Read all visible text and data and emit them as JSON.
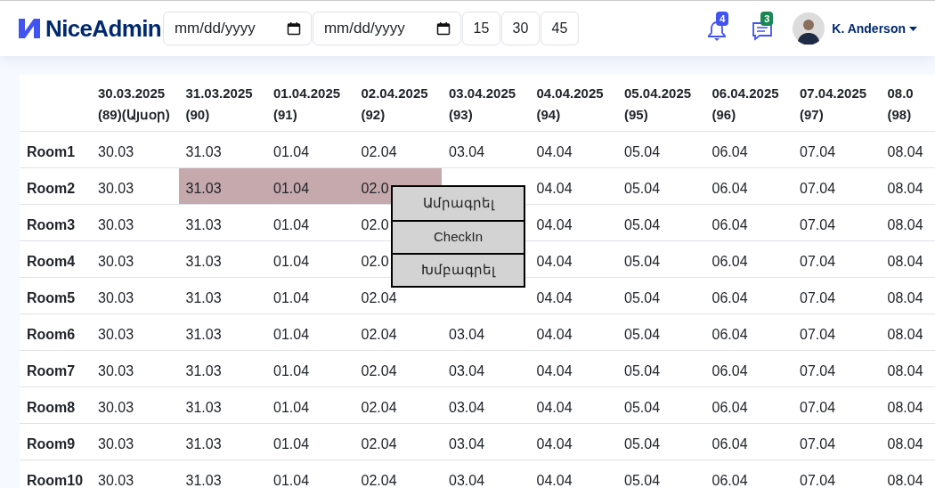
{
  "header": {
    "logo": "NiceAdmin",
    "date_fields": [
      {
        "placeholder": "mm/dd/yyyy"
      },
      {
        "placeholder": "mm/dd/yyyy"
      }
    ],
    "quick_buttons": [
      "15",
      "30",
      "45"
    ],
    "notifications": {
      "badge": "4"
    },
    "messages": {
      "badge": "3"
    },
    "user": {
      "name": "K. Anderson"
    }
  },
  "table": {
    "columns": [
      {
        "date": "30.03.2025",
        "sub": "(89)(Այսօր)"
      },
      {
        "date": "31.03.2025",
        "sub": "(90)"
      },
      {
        "date": "01.04.2025",
        "sub": "(91)"
      },
      {
        "date": "02.04.2025",
        "sub": "(92)"
      },
      {
        "date": "03.04.2025",
        "sub": "(93)"
      },
      {
        "date": "04.04.2025",
        "sub": "(94)"
      },
      {
        "date": "05.04.2025",
        "sub": "(95)"
      },
      {
        "date": "06.04.2025",
        "sub": "(96)"
      },
      {
        "date": "07.04.2025",
        "sub": "(97)"
      },
      {
        "date": "08.0",
        "sub": "(98)"
      }
    ],
    "rows": [
      {
        "room": "Room1",
        "cells": [
          {
            "text": "30.03",
            "booked": false
          },
          {
            "text": "31.03",
            "booked": false
          },
          {
            "text": "01.04",
            "booked": false
          },
          {
            "text": "02.04",
            "booked": false
          },
          {
            "text": "03.04",
            "booked": false
          },
          {
            "text": "04.04",
            "booked": false
          },
          {
            "text": "05.04",
            "booked": false
          },
          {
            "text": "06.04",
            "booked": false
          },
          {
            "text": "07.04",
            "booked": false
          },
          {
            "text": "08.04",
            "booked": false
          }
        ]
      },
      {
        "room": "Room2",
        "cells": [
          {
            "text": "30.03",
            "booked": false
          },
          {
            "text": "31.03",
            "booked": true
          },
          {
            "text": "01.04",
            "booked": true
          },
          {
            "text": "02.0",
            "booked": true
          },
          null,
          {
            "text": "04.04",
            "booked": false
          },
          {
            "text": "05.04",
            "booked": false
          },
          {
            "text": "06.04",
            "booked": false
          },
          {
            "text": "07.04",
            "booked": false
          },
          {
            "text": "08.04",
            "booked": false
          }
        ]
      },
      {
        "room": "Room3",
        "cells": [
          {
            "text": "30.03",
            "booked": false
          },
          {
            "text": "31.03",
            "booked": false
          },
          {
            "text": "01.04",
            "booked": false
          },
          {
            "text": "02.0",
            "booked": false
          },
          null,
          {
            "text": "04.04",
            "booked": false
          },
          {
            "text": "05.04",
            "booked": false
          },
          {
            "text": "06.04",
            "booked": false
          },
          {
            "text": "07.04",
            "booked": false
          },
          {
            "text": "08.04",
            "booked": false
          }
        ]
      },
      {
        "room": "Room4",
        "cells": [
          {
            "text": "30.03",
            "booked": false
          },
          {
            "text": "31.03",
            "booked": false
          },
          {
            "text": "01.04",
            "booked": false
          },
          {
            "text": "02.0",
            "booked": false
          },
          null,
          {
            "text": "04.04",
            "booked": false
          },
          {
            "text": "05.04",
            "booked": false
          },
          {
            "text": "06.04",
            "booked": false
          },
          {
            "text": "07.04",
            "booked": false
          },
          {
            "text": "08.04",
            "booked": false
          }
        ]
      },
      {
        "room": "Room5",
        "cells": [
          {
            "text": "30.03",
            "booked": false
          },
          {
            "text": "31.03",
            "booked": false
          },
          {
            "text": "01.04",
            "booked": false
          },
          {
            "text": "02.04",
            "booked": false
          },
          null,
          {
            "text": "04.04",
            "booked": false
          },
          {
            "text": "05.04",
            "booked": false
          },
          {
            "text": "06.04",
            "booked": false
          },
          {
            "text": "07.04",
            "booked": false
          },
          {
            "text": "08.04",
            "booked": false
          }
        ]
      },
      {
        "room": "Room6",
        "cells": [
          {
            "text": "30.03",
            "booked": false
          },
          {
            "text": "31.03",
            "booked": false
          },
          {
            "text": "01.04",
            "booked": false
          },
          {
            "text": "02.04",
            "booked": false
          },
          {
            "text": "03.04",
            "booked": false
          },
          {
            "text": "04.04",
            "booked": false
          },
          {
            "text": "05.04",
            "booked": false
          },
          {
            "text": "06.04",
            "booked": false
          },
          {
            "text": "07.04",
            "booked": false
          },
          {
            "text": "08.04",
            "booked": false
          }
        ]
      },
      {
        "room": "Room7",
        "cells": [
          {
            "text": "30.03",
            "booked": false
          },
          {
            "text": "31.03",
            "booked": false
          },
          {
            "text": "01.04",
            "booked": false
          },
          {
            "text": "02.04",
            "booked": false
          },
          {
            "text": "03.04",
            "booked": false
          },
          {
            "text": "04.04",
            "booked": false
          },
          {
            "text": "05.04",
            "booked": false
          },
          {
            "text": "06.04",
            "booked": false
          },
          {
            "text": "07.04",
            "booked": false
          },
          {
            "text": "08.04",
            "booked": false
          }
        ]
      },
      {
        "room": "Room8",
        "cells": [
          {
            "text": "30.03",
            "booked": false
          },
          {
            "text": "31.03",
            "booked": false
          },
          {
            "text": "01.04",
            "booked": false
          },
          {
            "text": "02.04",
            "booked": false
          },
          {
            "text": "03.04",
            "booked": false
          },
          {
            "text": "04.04",
            "booked": false
          },
          {
            "text": "05.04",
            "booked": false
          },
          {
            "text": "06.04",
            "booked": false
          },
          {
            "text": "07.04",
            "booked": false
          },
          {
            "text": "08.04",
            "booked": false
          }
        ]
      },
      {
        "room": "Room9",
        "cells": [
          {
            "text": "30.03",
            "booked": false
          },
          {
            "text": "31.03",
            "booked": false
          },
          {
            "text": "01.04",
            "booked": false
          },
          {
            "text": "02.04",
            "booked": false
          },
          {
            "text": "03.04",
            "booked": false
          },
          {
            "text": "04.04",
            "booked": false
          },
          {
            "text": "05.04",
            "booked": false
          },
          {
            "text": "06.04",
            "booked": false
          },
          {
            "text": "07.04",
            "booked": false
          },
          {
            "text": "08.04",
            "booked": false
          }
        ]
      },
      {
        "room": "Room10",
        "cells": [
          {
            "text": "30.03",
            "booked": false
          },
          {
            "text": "31.03",
            "booked": false
          },
          {
            "text": "01.04",
            "booked": false
          },
          {
            "text": "02.04",
            "booked": false
          },
          {
            "text": "03.04",
            "booked": false
          },
          {
            "text": "04.04",
            "booked": false
          },
          {
            "text": "05.04",
            "booked": false
          },
          {
            "text": "06.04",
            "booked": false
          },
          {
            "text": "07.04",
            "booked": false
          },
          {
            "text": "08.04",
            "booked": false
          }
        ]
      }
    ]
  },
  "context_menu": {
    "items": [
      "Ամրագրել",
      "CheckIn",
      "Խմբագրել"
    ]
  }
}
